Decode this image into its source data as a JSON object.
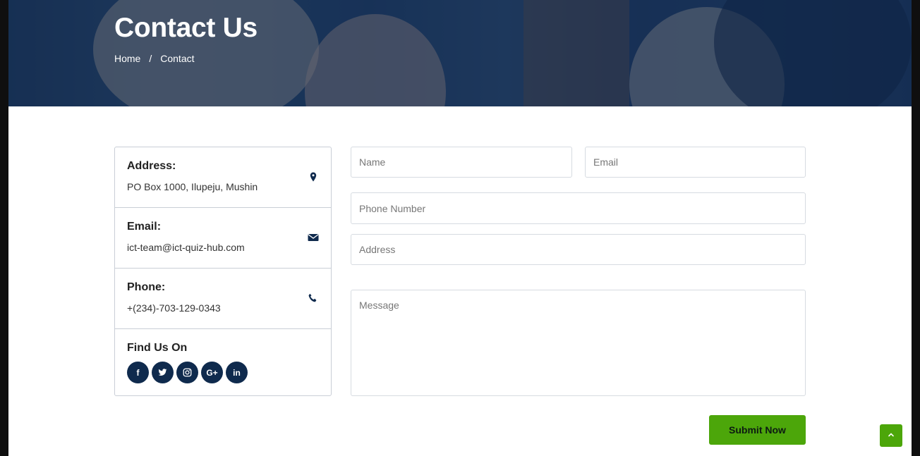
{
  "hero": {
    "title": "Contact Us",
    "breadcrumb": {
      "home": "Home",
      "separator": "/",
      "current": "Contact"
    }
  },
  "info": {
    "address": {
      "label": "Address:",
      "value": "PO Box 1000, Ilupeju, Mushin",
      "icon": "map-marker-icon"
    },
    "email": {
      "label": "Email:",
      "value": "ict-team@ict-quiz-hub.com",
      "icon": "envelope-icon"
    },
    "phone": {
      "label": "Phone:",
      "value": "+(234)-703-129-0343",
      "icon": "phone-icon"
    },
    "social": {
      "label": "Find Us On",
      "items": [
        {
          "icon": "facebook-icon",
          "glyph": "f"
        },
        {
          "icon": "twitter-icon",
          "glyph": "🐦"
        },
        {
          "icon": "instagram-icon",
          "glyph": "◎"
        },
        {
          "icon": "google-plus-icon",
          "glyph": "G+"
        },
        {
          "icon": "linkedin-icon",
          "glyph": "in"
        }
      ]
    }
  },
  "form": {
    "name_placeholder": "Name",
    "email_placeholder": "Email",
    "phone_placeholder": "Phone Number",
    "address_placeholder": "Address",
    "message_placeholder": "Message",
    "submit_label": "Submit Now"
  },
  "colors": {
    "primary": "#0f2a4d",
    "accent": "#4ca60a",
    "border": "#c9ced6"
  },
  "scroll_top": {
    "icon": "chevron-up-icon"
  }
}
